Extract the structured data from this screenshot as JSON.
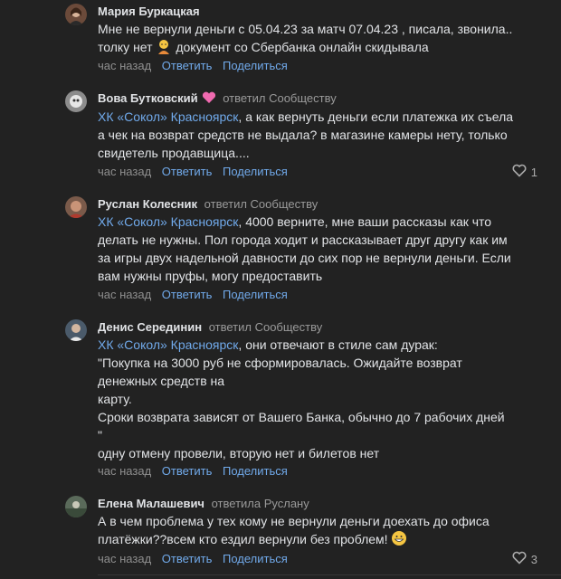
{
  "comments": [
    {
      "author": "Мария Буркацкая",
      "replied": "",
      "lines": [
        "Мне не вернули деньги с 05.04.23 за матч 07.04.23 , писала, звонила..",
        "толку нет",
        " документ со Сбербанка онлайн скидывала"
      ],
      "time": "час назад",
      "reply": "Ответить",
      "share": "Поделиться",
      "likes": ""
    },
    {
      "author": "Вова Бутковский",
      "replied": "ответил Сообществу",
      "mention": "ХК «Сокол» Красноярск",
      "lines": [
        ", а как вернуть деньги если платежка их съела",
        "а чек на возврат средств не выдала? в магазине камеры нету, только",
        "свидетель продавщица...."
      ],
      "time": "час назад",
      "reply": "Ответить",
      "share": "Поделиться",
      "likes": "1"
    },
    {
      "author": "Руслан Колесник",
      "replied": "ответил Сообществу",
      "mention": "ХК «Сокол» Красноярск",
      "lines": [
        ", 4000 верните, мне ваши рассказы как что",
        "делать не нужны. Пол города ходит и рассказывает друг другу как им",
        "за игры двух надельной давности до сих пор не вернули деньги. Если",
        "вам нужны пруфы, могу предоставить"
      ],
      "time": "час назад",
      "reply": "Ответить",
      "share": "Поделиться",
      "likes": ""
    },
    {
      "author": "Денис Серединин",
      "replied": "ответил Сообществу",
      "mention": "ХК «Сокол» Красноярск",
      "lines": [
        ", они отвечают в стиле сам дурак:",
        "\"Покупка на 3000 руб не сформировалась. Ожидайте возврат",
        "денежных средств на",
        "карту.",
        "Сроки возврата зависят от Вашего Банка, обычно до 7 рабочих дней",
        "\"",
        "одну отмену провели, вторую нет и билетов нет"
      ],
      "time": "час назад",
      "reply": "Ответить",
      "share": "Поделиться",
      "likes": ""
    },
    {
      "author": "Елена Малашевич",
      "replied": "ответила Руслану",
      "lines": [
        "А в чем проблема у тех кому не вернули деньги доехать до офиса",
        "платёжки??всем кто ездил вернули без проблем!"
      ],
      "time": "час назад",
      "reply": "Ответить",
      "share": "Поделиться",
      "likes": "3"
    }
  ]
}
